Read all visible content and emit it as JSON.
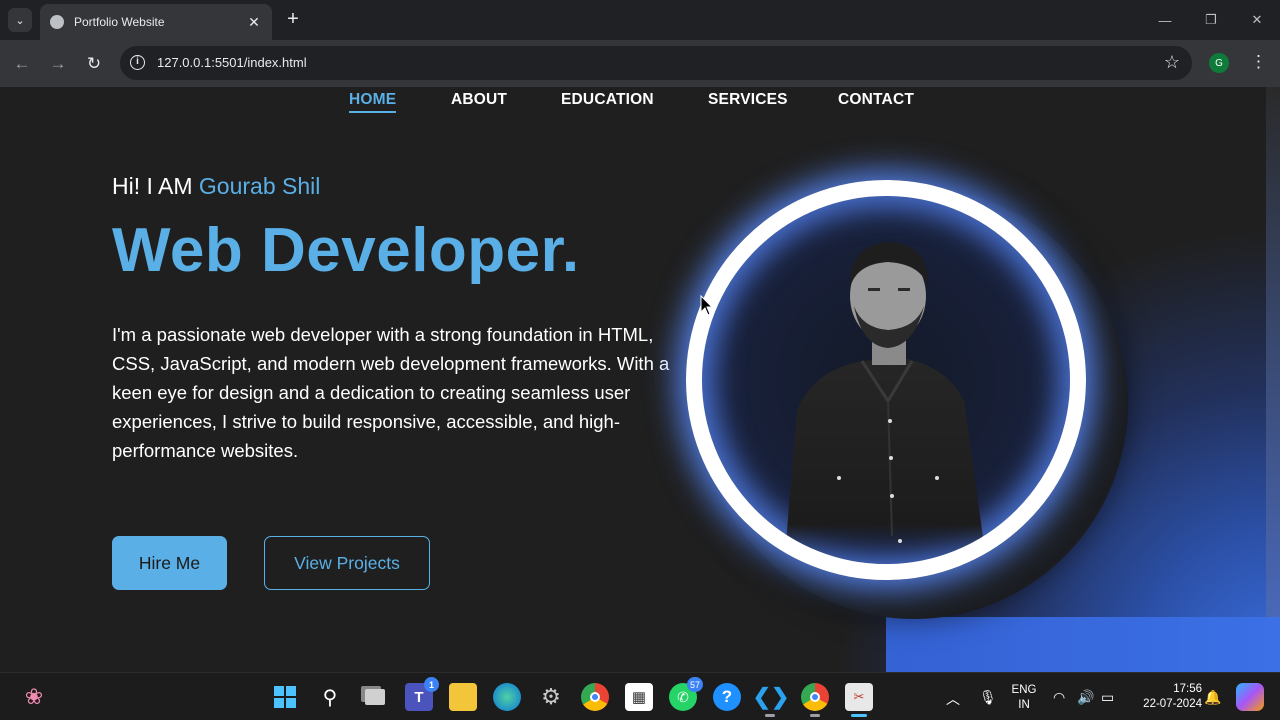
{
  "browser": {
    "tab_title": "Portfolio Website",
    "url": "127.0.0.1:5501/index.html",
    "profile_initial": "G"
  },
  "nav": {
    "items": [
      "HOME",
      "ABOUT",
      "EDUCATION",
      "SERVICES",
      "CONTACT"
    ],
    "active": "HOME"
  },
  "hero": {
    "greeting_prefix": "Hi! I AM",
    "name": "Gourab Shil",
    "headline": "Web Developer.",
    "bio": "I'm a passionate web developer with a strong foundation in HTML, CSS, JavaScript, and modern web development frameworks. With a keen eye for design and a dedication to creating seamless user experiences, I strive to build responsive, accessible, and high-performance websites.",
    "hire_label": "Hire Me",
    "projects_label": "View Projects"
  },
  "taskbar": {
    "teams_badge": "1",
    "whatsapp_badge": "57",
    "language_line1": "ENG",
    "language_line2": "IN",
    "time": "17:56",
    "date": "22-07-2024"
  },
  "colors": {
    "accent": "#5ab0e6",
    "page_bg": "#1f1f1f",
    "glow": "#5a8cff",
    "corner_gradient": "#3b70e6"
  }
}
